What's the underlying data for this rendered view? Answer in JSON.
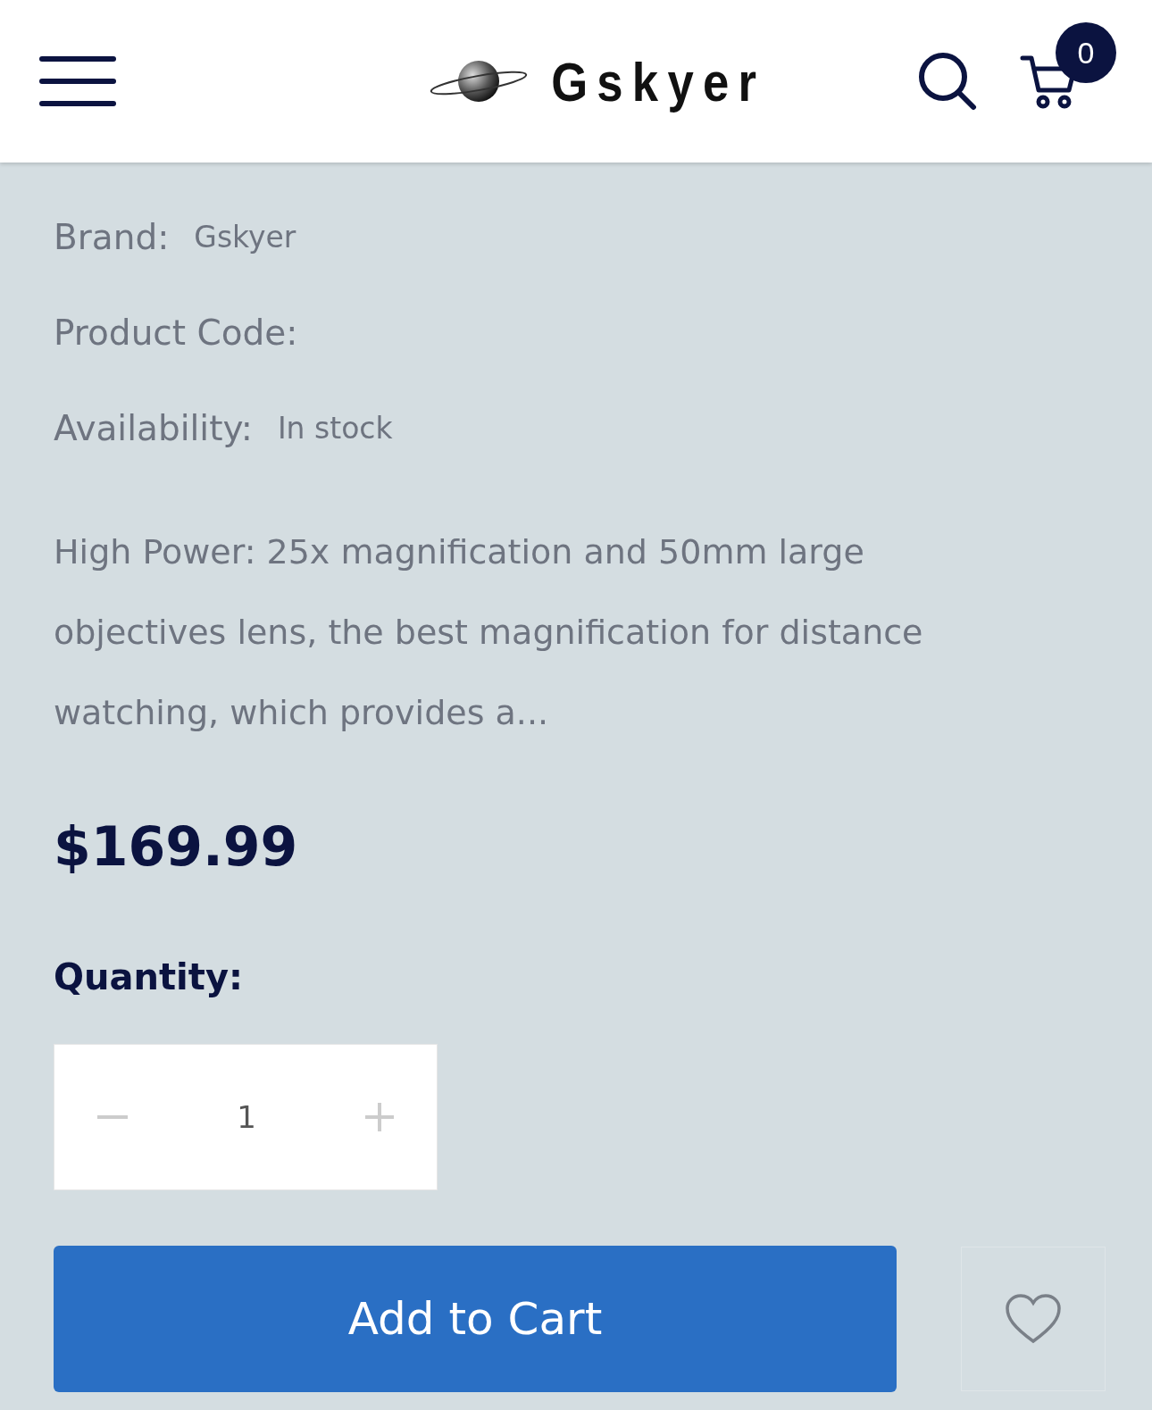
{
  "header": {
    "logo_text": "Gskyer",
    "cart_count": "0"
  },
  "details": [
    {
      "label": "Brand:",
      "value": "Gskyer"
    },
    {
      "label": "Product Code:"
    },
    {
      "label": "Availability:",
      "value": "In stock"
    }
  ],
  "description": "High Power: 25x magnification and 50mm large objectives lens, the best magnification for distance watching, which provides a...",
  "price": "$169.99",
  "quantity": {
    "label": "Quantity:",
    "value": "1"
  },
  "add_to_cart": "Add to Cart"
}
